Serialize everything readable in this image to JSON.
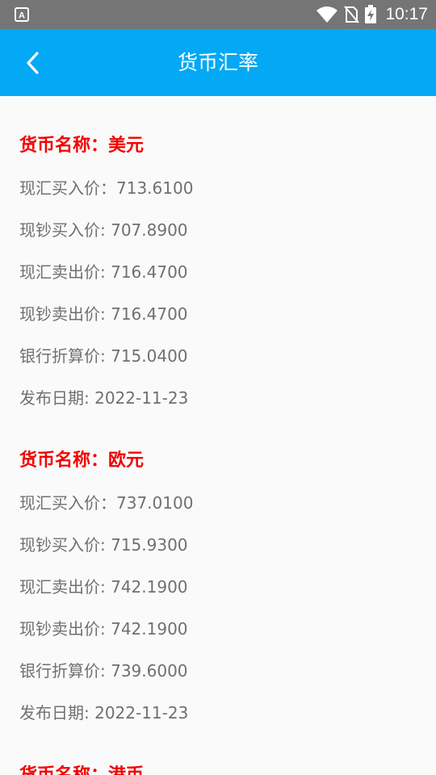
{
  "status_bar": {
    "time": "10:17",
    "badge": "A",
    "icons": [
      "wifi-icon",
      "no-sim-icon",
      "battery-charging-icon"
    ]
  },
  "app_bar": {
    "title": "货币汇率",
    "back_icon": "chevron-left-icon"
  },
  "colors": {
    "accent": "#03a9f4",
    "status_bar": "#757575",
    "currency_name": "#f40000",
    "text_gray": "#707070",
    "background": "#fafafa"
  },
  "currencies": [
    {
      "name": "货币名称：美元",
      "spot_buy": "现汇买入价：713.6100",
      "cash_buy": "现钞买入价: 707.8900",
      "spot_sell": "现汇卖出价: 716.4700",
      "cash_sell": "现钞卖出价: 716.4700",
      "conversion": "银行折算价: 715.0400",
      "date": "发布日期: 2022-11-23"
    },
    {
      "name": "货币名称：欧元",
      "spot_buy": "现汇买入价：737.0100",
      "cash_buy": "现钞买入价: 715.9300",
      "spot_sell": "现汇卖出价: 742.1900",
      "cash_sell": "现钞卖出价: 742.1900",
      "conversion": "银行折算价: 739.6000",
      "date": "发布日期: 2022-11-23"
    },
    {
      "name": "货币名称：港币"
    }
  ]
}
